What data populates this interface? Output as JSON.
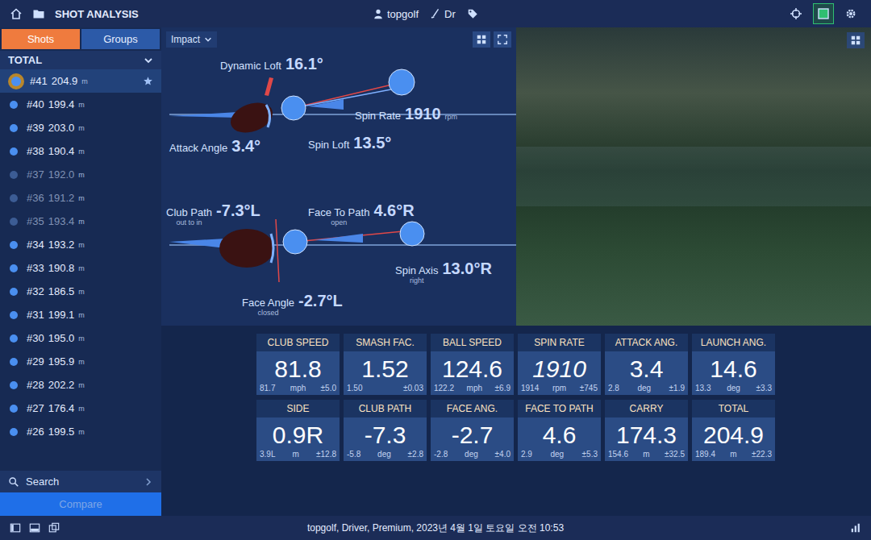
{
  "top_bar": {
    "title": "SHOT ANALYSIS",
    "user": "topgolf",
    "club": "Dr",
    "tools": [
      {
        "selected": false
      },
      {
        "selected": true
      },
      {
        "selected": false
      }
    ]
  },
  "sidebar": {
    "tabs": [
      {
        "label": "Shots",
        "selected": true
      },
      {
        "label": "Groups",
        "selected": false
      }
    ],
    "filter": "TOTAL",
    "shots": [
      {
        "number": "#41",
        "distance": "204.9",
        "unit": "m",
        "selected": true,
        "starred": true,
        "disabled": false
      },
      {
        "number": "#40",
        "distance": "199.4",
        "unit": "m",
        "selected": false,
        "starred": false,
        "disabled": false
      },
      {
        "number": "#39",
        "distance": "203.0",
        "unit": "m",
        "selected": false,
        "starred": false,
        "disabled": false
      },
      {
        "number": "#38",
        "distance": "190.4",
        "unit": "m",
        "selected": false,
        "starred": false,
        "disabled": false
      },
      {
        "number": "#37",
        "distance": "192.0",
        "unit": "m",
        "selected": false,
        "starred": false,
        "disabled": true
      },
      {
        "number": "#36",
        "distance": "191.2",
        "unit": "m",
        "selected": false,
        "starred": false,
        "disabled": true
      },
      {
        "number": "#35",
        "distance": "193.4",
        "unit": "m",
        "selected": false,
        "starred": false,
        "disabled": true
      },
      {
        "number": "#34",
        "distance": "193.2",
        "unit": "m",
        "selected": false,
        "starred": false,
        "disabled": false
      },
      {
        "number": "#33",
        "distance": "190.8",
        "unit": "m",
        "selected": false,
        "starred": false,
        "disabled": false
      },
      {
        "number": "#32",
        "distance": "186.5",
        "unit": "m",
        "selected": false,
        "starred": false,
        "disabled": false
      },
      {
        "number": "#31",
        "distance": "199.1",
        "unit": "m",
        "selected": false,
        "starred": false,
        "disabled": false
      },
      {
        "number": "#30",
        "distance": "195.0",
        "unit": "m",
        "selected": false,
        "starred": false,
        "disabled": false
      },
      {
        "number": "#29",
        "distance": "195.9",
        "unit": "m",
        "selected": false,
        "starred": false,
        "disabled": false
      },
      {
        "number": "#28",
        "distance": "202.2",
        "unit": "m",
        "selected": false,
        "starred": false,
        "disabled": false
      },
      {
        "number": "#27",
        "distance": "176.4",
        "unit": "m",
        "selected": false,
        "starred": false,
        "disabled": false
      },
      {
        "number": "#26",
        "distance": "199.5",
        "unit": "m",
        "selected": false,
        "starred": false,
        "disabled": false
      }
    ],
    "search": "Search",
    "compare": {
      "label": "Compare",
      "disabled": true
    }
  },
  "impact": {
    "view": "Impact",
    "readings": [
      {
        "label": "Dynamic Loft",
        "sub": "",
        "value": "16.1°",
        "unit": ""
      },
      {
        "label": "Spin Rate",
        "sub": "",
        "value": "1910",
        "unit": "rpm"
      },
      {
        "label": "Attack Angle",
        "sub": "",
        "value": "3.4°",
        "unit": ""
      },
      {
        "label": "Spin Loft",
        "sub": "",
        "value": "13.5°",
        "unit": ""
      },
      {
        "label": "Club Path",
        "sub": "out to in",
        "value": "-7.3°L",
        "unit": ""
      },
      {
        "label": "Face To Path",
        "sub": "open",
        "value": "4.6°R",
        "unit": ""
      },
      {
        "label": "Spin Axis",
        "sub": "right",
        "value": "13.0°R",
        "unit": ""
      },
      {
        "label": "Face Angle",
        "sub": "closed",
        "value": "-2.7°L",
        "unit": ""
      }
    ]
  },
  "metrics": [
    {
      "label": "CLUB SPEED",
      "value": "81.8",
      "average": "81.7",
      "unit": "mph",
      "spread": "±5.0",
      "estimated": false
    },
    {
      "label": "SMASH FAC.",
      "value": "1.52",
      "average": "1.50",
      "unit": "",
      "spread": "±0.03",
      "estimated": false
    },
    {
      "label": "BALL SPEED",
      "value": "124.6",
      "average": "122.2",
      "unit": "mph",
      "spread": "±6.9",
      "estimated": false
    },
    {
      "label": "SPIN RATE",
      "value": "1910",
      "average": "1914",
      "unit": "rpm",
      "spread": "±745",
      "estimated": true
    },
    {
      "label": "ATTACK ANG.",
      "value": "3.4",
      "average": "2.8",
      "unit": "deg",
      "spread": "±1.9",
      "estimated": false
    },
    {
      "label": "LAUNCH ANG.",
      "value": "14.6",
      "average": "13.3",
      "unit": "deg",
      "spread": "±3.3",
      "estimated": false
    },
    {
      "label": "SIDE",
      "value": "0.9R",
      "average": "3.9L",
      "unit": "m",
      "spread": "±12.8",
      "estimated": false
    },
    {
      "label": "CLUB PATH",
      "value": "-7.3",
      "average": "-5.8",
      "unit": "deg",
      "spread": "±2.8",
      "estimated": false
    },
    {
      "label": "FACE ANG.",
      "value": "-2.7",
      "average": "-2.8",
      "unit": "deg",
      "spread": "±4.0",
      "estimated": false
    },
    {
      "label": "FACE TO PATH",
      "value": "4.6",
      "average": "2.9",
      "unit": "deg",
      "spread": "±5.3",
      "estimated": false
    },
    {
      "label": "CARRY",
      "value": "174.3",
      "average": "154.6",
      "unit": "m",
      "spread": "±32.5",
      "estimated": false
    },
    {
      "label": "TOTAL",
      "value": "204.9",
      "average": "189.4",
      "unit": "m",
      "spread": "±22.3",
      "estimated": false
    }
  ],
  "status_bar": "topgolf, Driver, Premium, 2023년 4월 1일 토요일 오전 10:53"
}
